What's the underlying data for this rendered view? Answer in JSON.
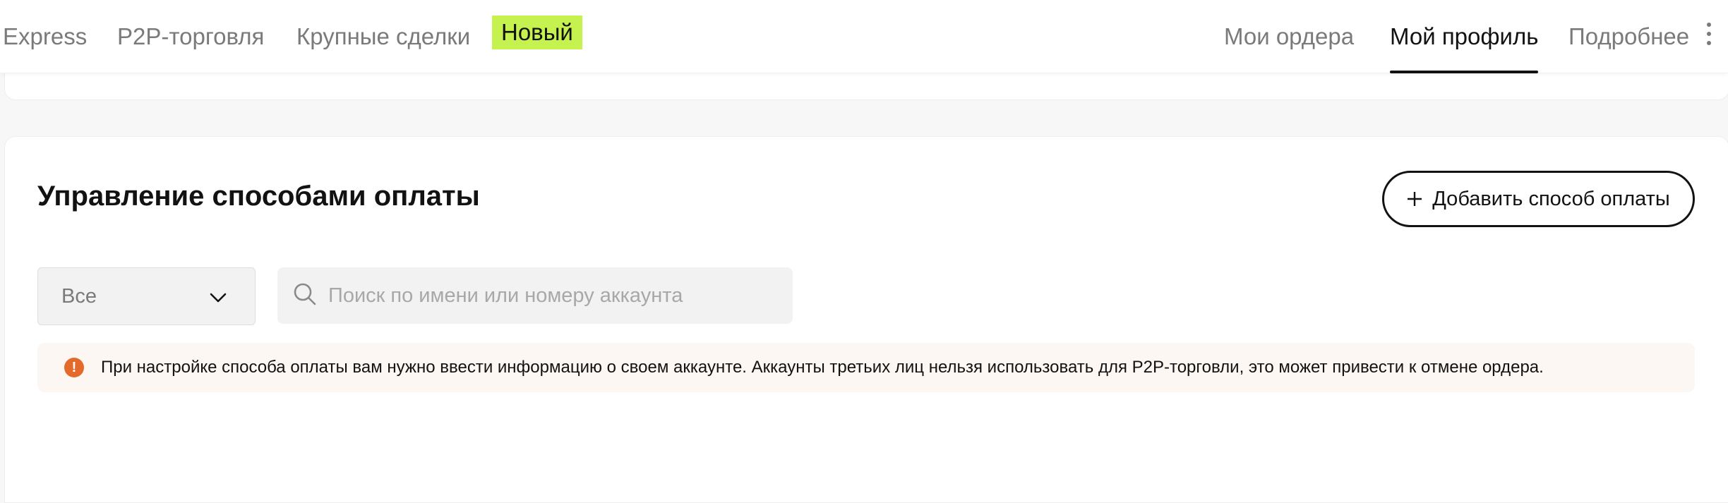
{
  "nav": {
    "left_items": [
      "Express",
      "P2P-торговля",
      "Крупные сделки"
    ],
    "badge": "Новый",
    "right_items": [
      "Мои ордера",
      "Мой профиль",
      "Подробнее"
    ],
    "active_item": "Мой профиль"
  },
  "payment_methods": {
    "title": "Управление способами оплаты",
    "add_button_label": "Добавить способ оплаты",
    "filter": {
      "selected": "Все"
    },
    "search": {
      "placeholder": "Поиск по имени или номеру аккаунта",
      "value": ""
    },
    "notice": "При настройке способа оплаты вам нужно ввести информацию о своем аккаунте. Аккаунты третьих лиц нельзя использовать для P2P-торговли, это может привести к отмене ордера."
  },
  "colors": {
    "badge_bg": "#c6f24f",
    "alert_orange": "#e36a2b",
    "text_dark": "#121212",
    "text_muted": "#7a7a7a"
  },
  "icons": [
    "plus-icon",
    "chevron-down-icon",
    "search-icon",
    "alert-icon",
    "more-vertical-icon"
  ]
}
